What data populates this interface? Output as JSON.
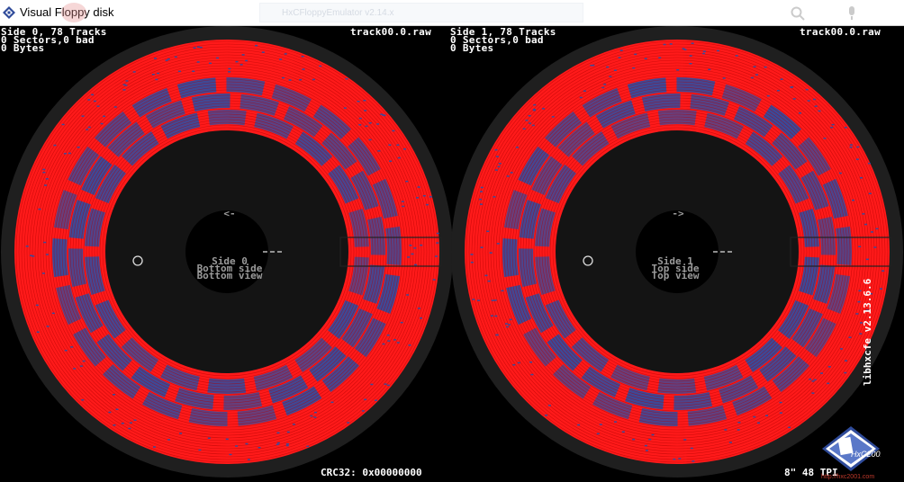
{
  "window": {
    "title": "Visual Floppy disk",
    "background_tab": "HxCFloppyEmulator v2.14.x"
  },
  "sides": [
    {
      "info_line1": "Side 0, 78 Tracks",
      "info_line2": "0 Sectors,0 bad",
      "info_line3": "0 Bytes",
      "filename": "track00.0.raw",
      "arrow": "<-",
      "label_line1": "Side 0",
      "label_line2": "Bottom side",
      "label_line3": "Bottom view"
    },
    {
      "info_line1": "Side 1, 78 Tracks",
      "info_line2": "0 Sectors,0 bad",
      "info_line3": "0 Bytes",
      "filename": "track00.0.raw",
      "arrow": "->",
      "label_line1": "Side 1",
      "label_line2": "Top side",
      "label_line3": "Top view"
    }
  ],
  "footer": {
    "crc": "CRC32: 0x00000000",
    "format": "8\" 48 TPI",
    "version": "libhxcfe v2.13.6.6",
    "logo_text": "HxC2001",
    "url": "http://hxc2001.com"
  },
  "colors": {
    "track_fill": "#ff1a1a",
    "sector_blue": "#3a4a9a",
    "disk_hub": "#141414",
    "surround": "#1f1f1f"
  },
  "icons": {
    "app": "floppy-diamond-icon",
    "logo": "hxc2001-logo"
  }
}
